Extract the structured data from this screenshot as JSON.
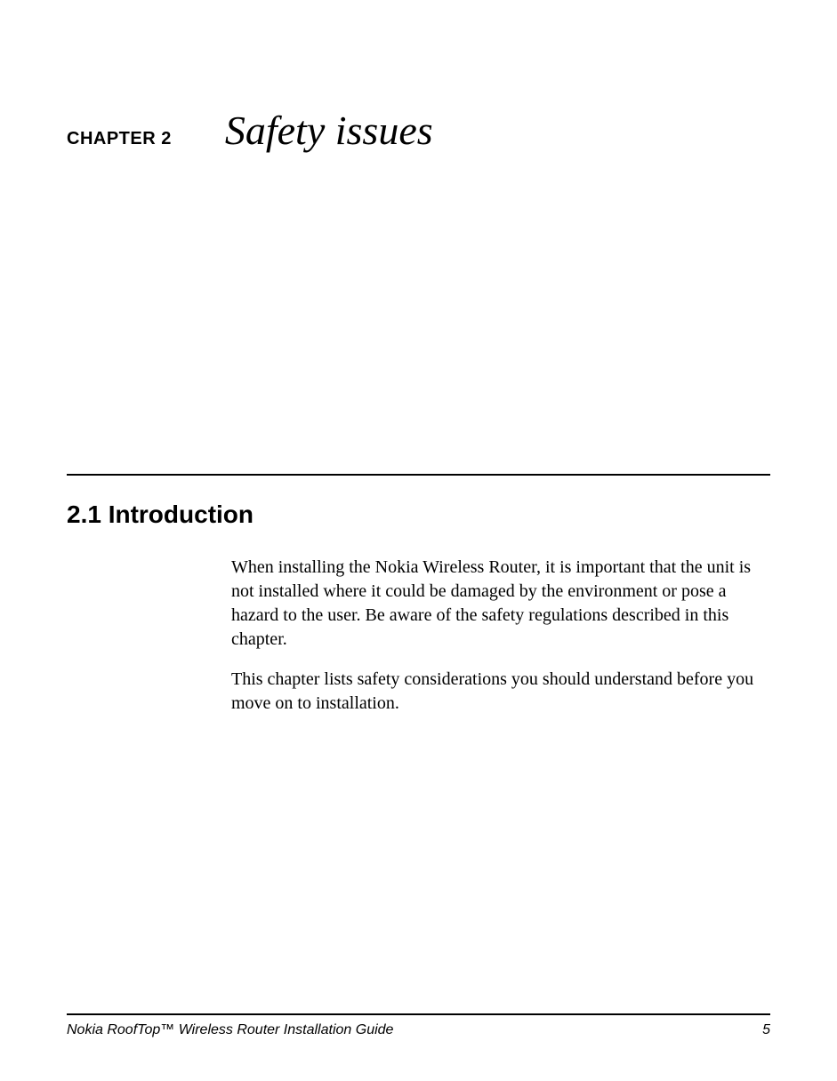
{
  "chapter": {
    "label": "CHAPTER 2",
    "title": "Safety issues"
  },
  "section": {
    "heading": "2.1 Introduction",
    "paragraphs": [
      "When installing the Nokia Wireless Router, it is important that the unit is not installed where it could be damaged by the environment or pose a hazard to the user. Be aware of the safety regulations described in this chapter.",
      "This chapter lists safety considerations you should understand before you move on to installation."
    ]
  },
  "footer": {
    "title": "Nokia RoofTop™ Wireless Router Installation Guide",
    "page": "5"
  }
}
